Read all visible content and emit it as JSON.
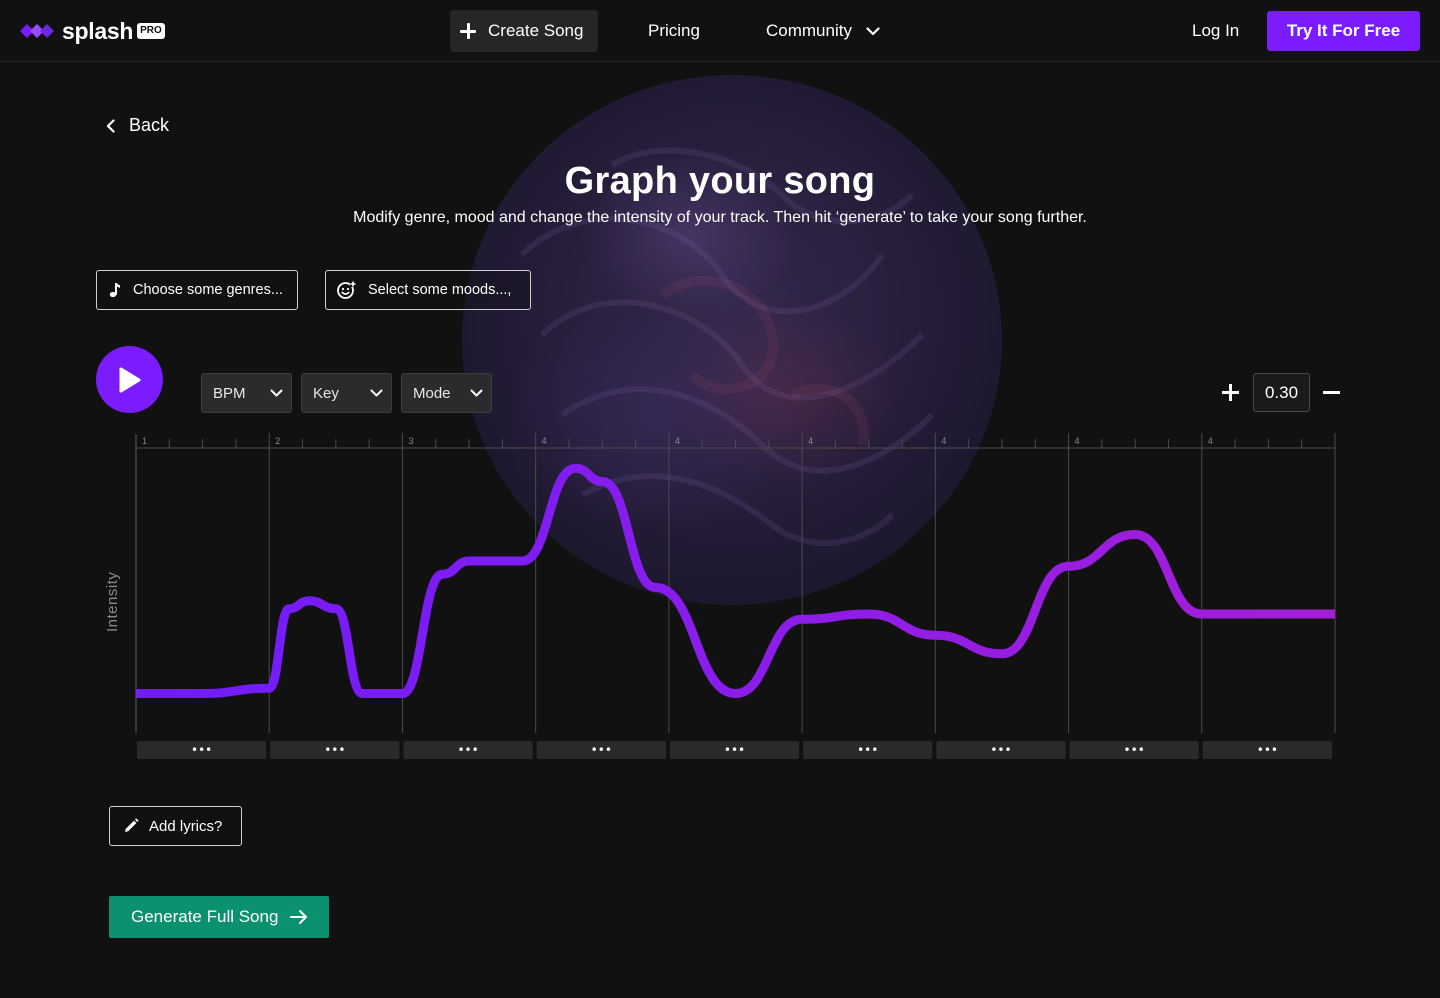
{
  "app": {
    "logo_text": "splash",
    "logo_badge": "PRO",
    "accent_color": "#7b1cff",
    "cta_color": "#0b9170"
  },
  "nav": {
    "create_song": "Create Song",
    "pricing": "Pricing",
    "community": "Community",
    "login": "Log In",
    "try_free": "Try It For Free"
  },
  "page": {
    "back": "Back",
    "title": "Graph your song",
    "subtitle": "Modify genre, mood and change the intensity of your track. Then hit ‘generate’ to take your song further."
  },
  "filters": {
    "genres_placeholder": "Choose some genres...",
    "moods_placeholder": "Select some moods...,"
  },
  "controls": {
    "bpm": "BPM",
    "key": "Key",
    "mode": "Mode",
    "zoom_value": "0.30"
  },
  "graph": {
    "ylabel": "Intensity",
    "section_markers": [
      "1",
      "2",
      "3",
      "4",
      "4",
      "4",
      "4",
      "4",
      "4"
    ],
    "section_menu_label": "•••",
    "line_colors": [
      "#6f1cff",
      "#a51ed6"
    ]
  },
  "chart_data": {
    "type": "line",
    "ylabel": "Intensity",
    "x": [
      0,
      0.5,
      1,
      1.15,
      1.3,
      1.5,
      1.7,
      2,
      2.3,
      2.5,
      2.9,
      3.3,
      3.5,
      3.9,
      4.5,
      5,
      5.5,
      6,
      6.5,
      7,
      7.5,
      8,
      9
    ],
    "values": [
      0.1,
      0.1,
      0.12,
      0.42,
      0.45,
      0.42,
      0.1,
      0.1,
      0.55,
      0.6,
      0.6,
      0.95,
      0.9,
      0.5,
      0.1,
      0.38,
      0.4,
      0.32,
      0.25,
      0.58,
      0.7,
      0.4,
      0.4
    ]
  },
  "actions": {
    "add_lyrics": "Add lyrics?",
    "generate": "Generate Full Song"
  }
}
